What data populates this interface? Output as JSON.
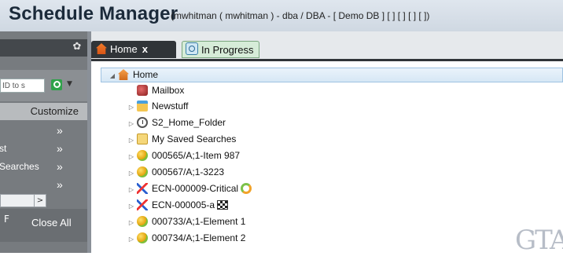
{
  "app": {
    "title": "Schedule Manager",
    "session_info": "(mwhitman ( mwhitman ) - dba / DBA - [ Demo DB ] [ ] [ ] [ ] [ ])"
  },
  "left_panel": {
    "search_placeholder": "ID to s",
    "customize_label": "Customize",
    "rows": [
      {
        "label": "",
        "chevron": "»"
      },
      {
        "label": "st",
        "chevron": "»"
      },
      {
        "label": "Searches",
        "chevron": "»"
      },
      {
        "label": "",
        "chevron": "»"
      }
    ],
    "scroll_arrow": ">",
    "close_all_label": "Close All",
    "bottom_mark": "F"
  },
  "tabs": [
    {
      "label": "Home",
      "icon": "home-icon",
      "close": "x",
      "active": true
    },
    {
      "label": "In Progress",
      "icon": "in-progress-icon",
      "active": false
    }
  ],
  "tree": {
    "root": {
      "label": "Home",
      "icon": "home-icon",
      "expander": "◢"
    },
    "items": [
      {
        "label": "Mailbox",
        "icon": "mailbox-icon",
        "expandable": false
      },
      {
        "label": "Newstuff",
        "icon": "folder-blue-icon",
        "expandable": true
      },
      {
        "label": "S2_Home_Folder",
        "icon": "clock-folder-icon",
        "expandable": true
      },
      {
        "label": "My Saved Searches",
        "icon": "folder-icon",
        "expandable": true
      },
      {
        "label": "000565/A;1-Item 987",
        "icon": "part-icon",
        "expandable": true
      },
      {
        "label": "000567/A;1-3223",
        "icon": "part-icon",
        "expandable": true
      },
      {
        "label": "ECN-000009-Critical",
        "icon": "ecn-icon",
        "expandable": true,
        "badge": "cycle-icon"
      },
      {
        "label": "ECN-000005-a",
        "icon": "ecn-icon",
        "expandable": true,
        "badge": "checkered-flag-icon"
      },
      {
        "label": "000733/A;1-Element 1",
        "icon": "part-icon",
        "expandable": true
      },
      {
        "label": "000734/A;1-Element 2",
        "icon": "part-icon",
        "expandable": true
      }
    ]
  },
  "watermark": "GTAC"
}
